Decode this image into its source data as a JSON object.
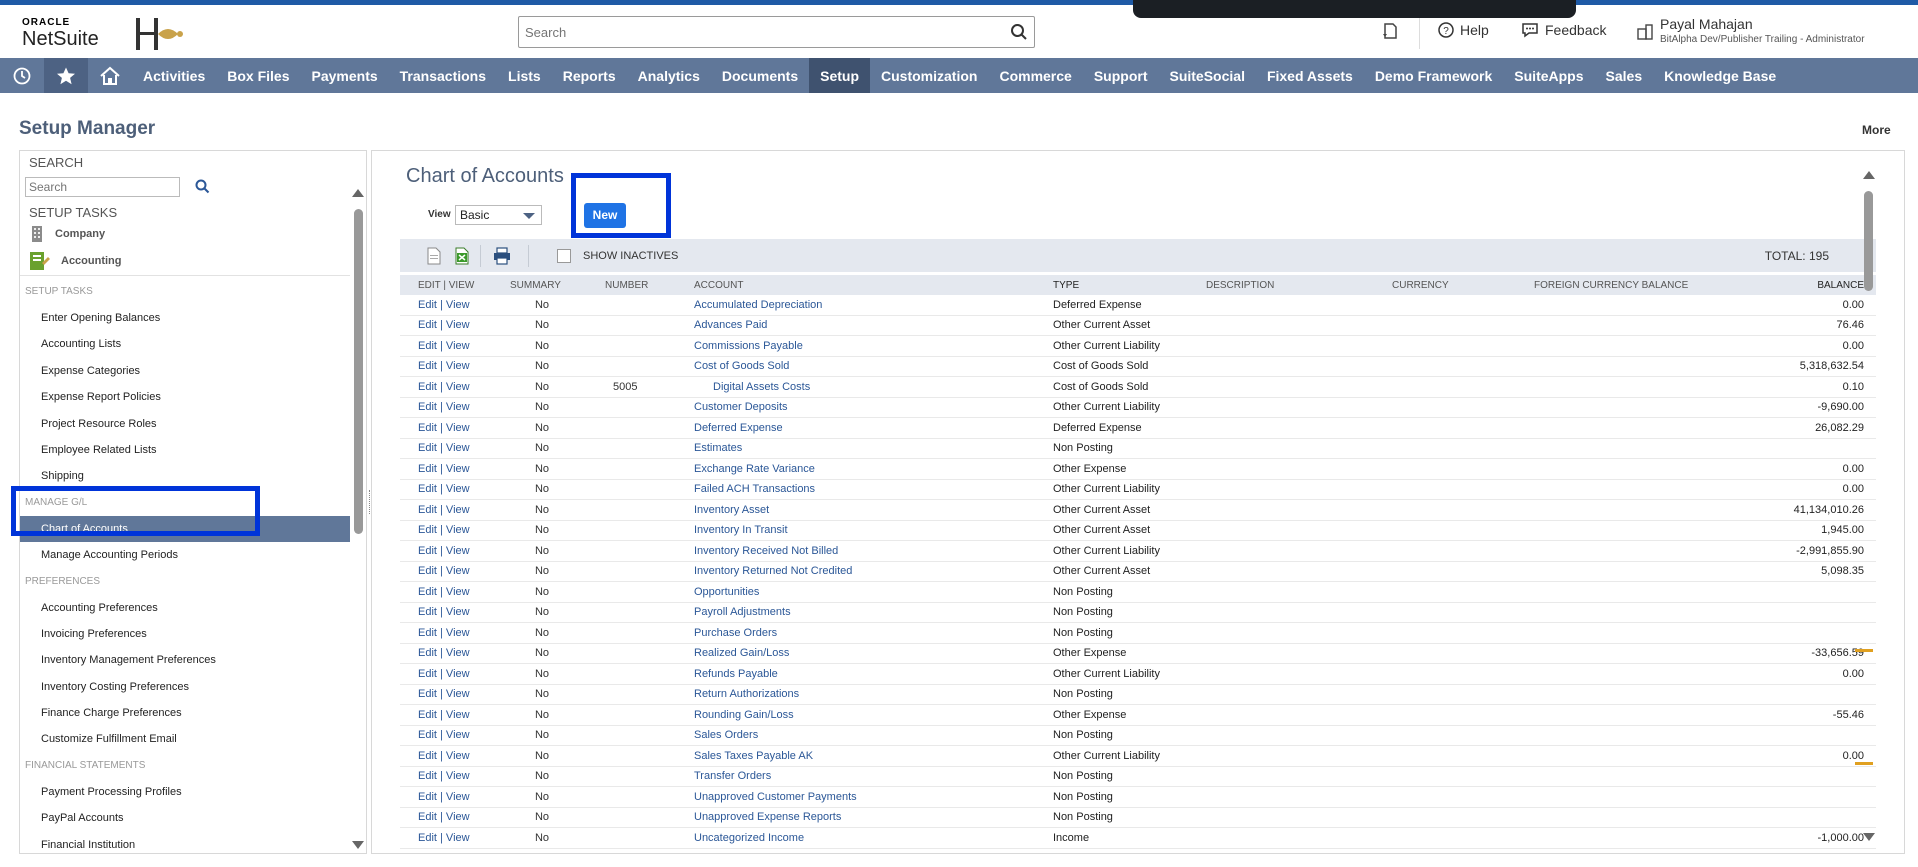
{
  "header": {
    "logo_top": "ORACLE",
    "logo_bottom": "NetSuite",
    "search_placeholder": "Search",
    "help": "Help",
    "feedback": "Feedback",
    "user_name": "Payal Mahajan",
    "user_role": "BitAlpha Dev/Publisher Trailing - Administrator"
  },
  "nav": {
    "items": [
      "Activities",
      "Box Files",
      "Payments",
      "Transactions",
      "Lists",
      "Reports",
      "Analytics",
      "Documents",
      "Setup",
      "Customization",
      "Commerce",
      "Support",
      "SuiteSocial",
      "Fixed Assets",
      "Demo Framework",
      "SuiteApps",
      "Sales",
      "Knowledge Base"
    ],
    "active": "Setup"
  },
  "page": {
    "title": "Setup Manager",
    "more": "More"
  },
  "left_panel": {
    "search_title": "SEARCH",
    "search_placeholder": "Search",
    "setup_tasks_title": "SETUP TASKS",
    "categories": [
      "Company",
      "Accounting"
    ],
    "sections": [
      {
        "heading": "SETUP TASKS",
        "items": [
          "Enter Opening Balances",
          "Accounting Lists",
          "Expense Categories",
          "Expense Report Policies",
          "Project Resource Roles",
          "Employee Related Lists",
          "Shipping"
        ]
      },
      {
        "heading": "MANAGE G/L",
        "items": [
          "Chart of Accounts",
          "Manage Accounting Periods"
        ]
      },
      {
        "heading": "PREFERENCES",
        "items": [
          "Accounting Preferences",
          "Invoicing Preferences",
          "Inventory Management Preferences",
          "Inventory Costing Preferences",
          "Finance Charge Preferences",
          "Customize Fulfillment Email"
        ]
      },
      {
        "heading": "FINANCIAL STATEMENTS",
        "items": [
          "Payment Processing Profiles",
          "PayPal Accounts",
          "Financial Institution"
        ]
      }
    ],
    "active_item": "Chart of Accounts"
  },
  "main": {
    "title": "Chart of Accounts",
    "view_label": "View",
    "view_value": "Basic",
    "new_button": "New",
    "show_inactives": "SHOW INACTIVES",
    "total": "TOTAL: 195",
    "columns": [
      "EDIT | VIEW",
      "SUMMARY",
      "NUMBER",
      "ACCOUNT",
      "TYPE",
      "DESCRIPTION",
      "CURRENCY",
      "FOREIGN CURRENCY BALANCE",
      "BALANCE"
    ],
    "edit_view_label": "Edit | View",
    "rows": [
      {
        "summary": "No",
        "number": "",
        "account": "Accumulated Depreciation",
        "type": "Deferred Expense",
        "balance": "0.00",
        "sub": false
      },
      {
        "summary": "No",
        "number": "",
        "account": "Advances Paid",
        "type": "Other Current Asset",
        "balance": "76.46",
        "sub": false
      },
      {
        "summary": "No",
        "number": "",
        "account": "Commissions Payable",
        "type": "Other Current Liability",
        "balance": "0.00",
        "sub": false
      },
      {
        "summary": "No",
        "number": "",
        "account": "Cost of Goods Sold",
        "type": "Cost of Goods Sold",
        "balance": "5,318,632.54",
        "sub": false
      },
      {
        "summary": "No",
        "number": "5005",
        "account": "Digital Assets Costs",
        "type": "Cost of Goods Sold",
        "balance": "0.10",
        "sub": true
      },
      {
        "summary": "No",
        "number": "",
        "account": "Customer Deposits",
        "type": "Other Current Liability",
        "balance": "-9,690.00",
        "sub": false
      },
      {
        "summary": "No",
        "number": "",
        "account": "Deferred Expense",
        "type": "Deferred Expense",
        "balance": "26,082.29",
        "sub": false
      },
      {
        "summary": "No",
        "number": "",
        "account": "Estimates",
        "type": "Non Posting",
        "balance": "",
        "sub": false
      },
      {
        "summary": "No",
        "number": "",
        "account": "Exchange Rate Variance",
        "type": "Other Expense",
        "balance": "0.00",
        "sub": false
      },
      {
        "summary": "No",
        "number": "",
        "account": "Failed ACH Transactions",
        "type": "Other Current Liability",
        "balance": "0.00",
        "sub": false
      },
      {
        "summary": "No",
        "number": "",
        "account": "Inventory Asset",
        "type": "Other Current Asset",
        "balance": "41,134,010.26",
        "sub": false
      },
      {
        "summary": "No",
        "number": "",
        "account": "Inventory In Transit",
        "type": "Other Current Asset",
        "balance": "1,945.00",
        "sub": false
      },
      {
        "summary": "No",
        "number": "",
        "account": "Inventory Received Not Billed",
        "type": "Other Current Liability",
        "balance": "-2,991,855.90",
        "sub": false
      },
      {
        "summary": "No",
        "number": "",
        "account": "Inventory Returned Not Credited",
        "type": "Other Current Asset",
        "balance": "5,098.35",
        "sub": false
      },
      {
        "summary": "No",
        "number": "",
        "account": "Opportunities",
        "type": "Non Posting",
        "balance": "",
        "sub": false
      },
      {
        "summary": "No",
        "number": "",
        "account": "Payroll Adjustments",
        "type": "Non Posting",
        "balance": "",
        "sub": false
      },
      {
        "summary": "No",
        "number": "",
        "account": "Purchase Orders",
        "type": "Non Posting",
        "balance": "",
        "sub": false
      },
      {
        "summary": "No",
        "number": "",
        "account": "Realized Gain/Loss",
        "type": "Other Expense",
        "balance": "-33,656.59",
        "sub": false
      },
      {
        "summary": "No",
        "number": "",
        "account": "Refunds Payable",
        "type": "Other Current Liability",
        "balance": "0.00",
        "sub": false
      },
      {
        "summary": "No",
        "number": "",
        "account": "Return Authorizations",
        "type": "Non Posting",
        "balance": "",
        "sub": false
      },
      {
        "summary": "No",
        "number": "",
        "account": "Rounding Gain/Loss",
        "type": "Other Expense",
        "balance": "-55.46",
        "sub": false
      },
      {
        "summary": "No",
        "number": "",
        "account": "Sales Orders",
        "type": "Non Posting",
        "balance": "",
        "sub": false
      },
      {
        "summary": "No",
        "number": "",
        "account": "Sales Taxes Payable AK",
        "type": "Other Current Liability",
        "balance": "0.00",
        "sub": false
      },
      {
        "summary": "No",
        "number": "",
        "account": "Transfer Orders",
        "type": "Non Posting",
        "balance": "",
        "sub": false
      },
      {
        "summary": "No",
        "number": "",
        "account": "Unapproved Customer Payments",
        "type": "Non Posting",
        "balance": "",
        "sub": false
      },
      {
        "summary": "No",
        "number": "",
        "account": "Unapproved Expense Reports",
        "type": "Non Posting",
        "balance": "",
        "sub": false
      },
      {
        "summary": "No",
        "number": "",
        "account": "Uncategorized Income",
        "type": "Income",
        "balance": "-1,000.00",
        "sub": false
      }
    ]
  },
  "colors": {
    "nav_bg": "#607799",
    "nav_active": "#3f526f",
    "link": "#2b5797",
    "highlight": "#0034d9",
    "new_button": "#1f73e5"
  }
}
